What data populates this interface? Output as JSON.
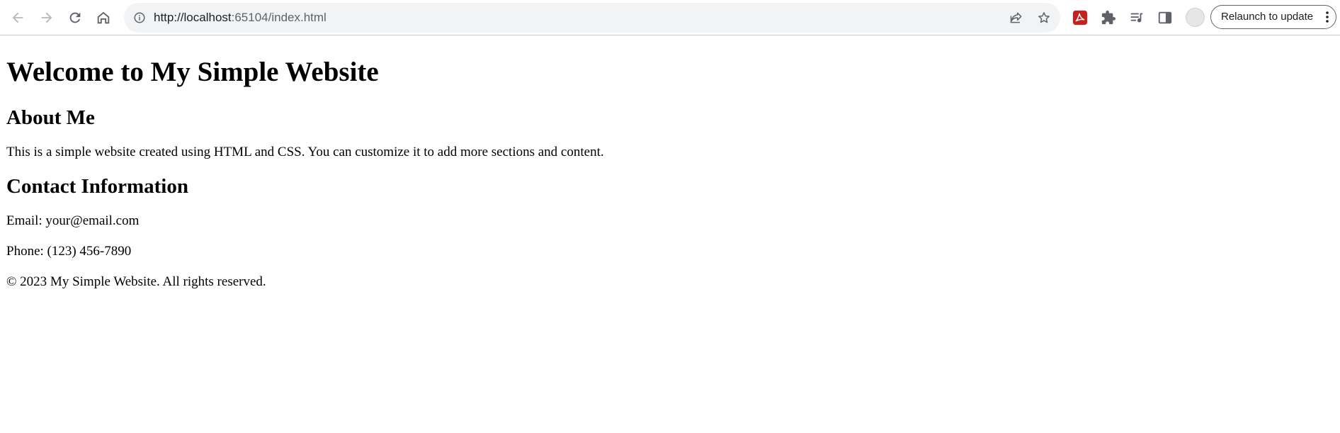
{
  "browser": {
    "url_host": "http://localhost",
    "url_rest": ":65104/index.html",
    "relaunch_label": "Relaunch to update",
    "accent_pdf": "#c5221f"
  },
  "page": {
    "heading": "Welcome to My Simple Website",
    "about": {
      "heading": "About Me",
      "text": "This is a simple website created using HTML and CSS. You can customize it to add more sections and content."
    },
    "contact": {
      "heading": "Contact Information",
      "email": "Email: your@email.com",
      "phone": "Phone: (123) 456-7890"
    },
    "footer": "© 2023 My Simple Website. All rights reserved."
  }
}
